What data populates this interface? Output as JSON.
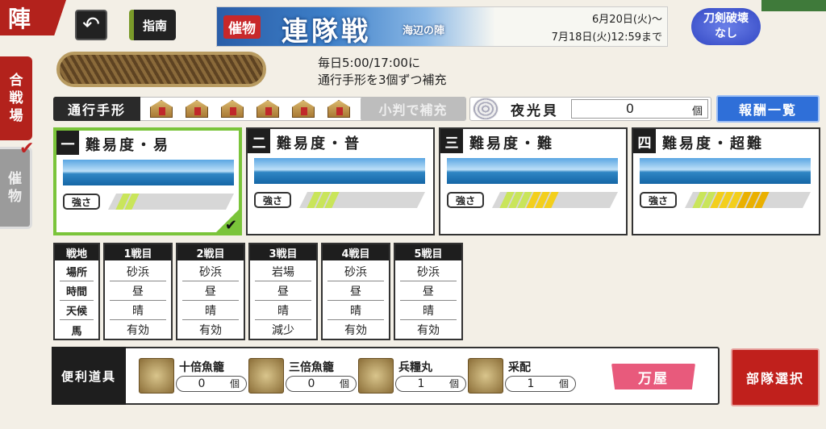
{
  "header": {
    "tab_label": "陣",
    "guide_label": "指南",
    "back_icon": "back-arrow-icon"
  },
  "side_tabs": [
    {
      "label_lines": [
        "合",
        "戦",
        "場"
      ],
      "state": "active"
    },
    {
      "label_lines": [
        "催",
        "物"
      ],
      "state": "checked"
    }
  ],
  "banner": {
    "tag": "催物",
    "title": "連隊戦",
    "subtitle": "海辺の陣",
    "date_start": "6月20日(火)～",
    "date_end": "7月18日(火)12:59まで"
  },
  "badge": {
    "line1": "刀剣破壊",
    "line2": "なし"
  },
  "notice": {
    "line1": "毎日5:00/17:00に",
    "line2": "通行手形を3個ずつ補充"
  },
  "pass": {
    "label": "通行手形",
    "count": 6,
    "refill_label": "小判で補充"
  },
  "shell": {
    "label": "夜光貝",
    "count": "0",
    "unit": "個"
  },
  "reward_label": "報酬一覧",
  "difficulties": [
    {
      "num": "一",
      "title": "難易度・易",
      "strength_label": "強さ",
      "level": 2,
      "selected": true
    },
    {
      "num": "二",
      "title": "難易度・普",
      "strength_label": "強さ",
      "level": 3,
      "selected": false
    },
    {
      "num": "三",
      "title": "難易度・難",
      "strength_label": "強さ",
      "level": 6,
      "selected": false
    },
    {
      "num": "四",
      "title": "難易度・超難",
      "strength_label": "強さ",
      "level": 8,
      "selected": false
    }
  ],
  "battle_table": {
    "row_labels": [
      "戦地",
      "場所",
      "時間",
      "天候",
      "馬"
    ],
    "columns": [
      {
        "header": "1戦目",
        "cells": [
          "砂浜",
          "昼",
          "晴",
          "有効"
        ]
      },
      {
        "header": "2戦目",
        "cells": [
          "砂浜",
          "昼",
          "晴",
          "有効"
        ]
      },
      {
        "header": "3戦目",
        "cells": [
          "岩場",
          "昼",
          "晴",
          "減少"
        ]
      },
      {
        "header": "4戦目",
        "cells": [
          "砂浜",
          "昼",
          "晴",
          "有効"
        ]
      },
      {
        "header": "5戦目",
        "cells": [
          "砂浜",
          "昼",
          "晴",
          "有効"
        ]
      }
    ]
  },
  "items": {
    "label": "便利道具",
    "list": [
      {
        "name": "十倍魚籠",
        "count": "0",
        "unit": "個",
        "icon": "fish-basket-icon"
      },
      {
        "name": "三倍魚籠",
        "count": "0",
        "unit": "個",
        "icon": "fish-basket-icon"
      },
      {
        "name": "兵糧丸",
        "count": "1",
        "unit": "個",
        "icon": "ration-pills-icon"
      },
      {
        "name": "采配",
        "count": "1",
        "unit": "個",
        "icon": "baton-icon"
      }
    ],
    "shop_label": "万屋"
  },
  "squad_label": "部隊選択",
  "colors": {
    "accent_red": "#b3221c",
    "selected_green": "#7ac43a",
    "reward_blue": "#2f6fd8",
    "shop_pink": "#e85a7c"
  }
}
